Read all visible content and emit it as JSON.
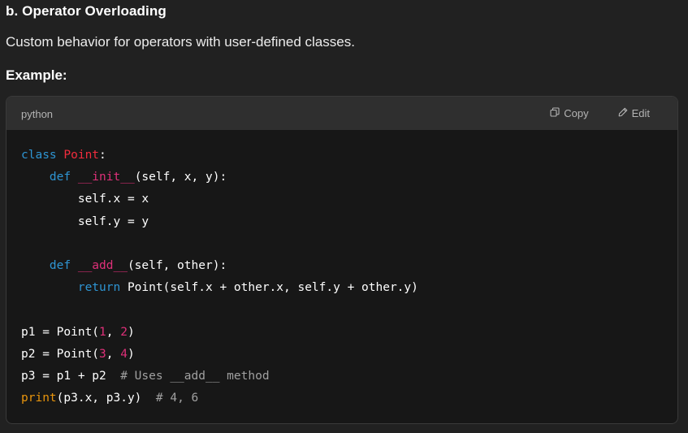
{
  "heading": "b. Operator Overloading",
  "description": "Custom behavior for operators with user-defined classes.",
  "example_label": "Example:",
  "code_block": {
    "language": "python",
    "copy_label": "Copy",
    "edit_label": "Edit",
    "lines": [
      [
        {
          "t": "class ",
          "c": "kw"
        },
        {
          "t": "Point",
          "c": "cls"
        },
        {
          "t": ":",
          "c": "t"
        }
      ],
      [
        {
          "t": "    ",
          "c": "t"
        },
        {
          "t": "def ",
          "c": "kw"
        },
        {
          "t": "__init__",
          "c": "fn"
        },
        {
          "t": "(self, x, y):",
          "c": "t"
        }
      ],
      [
        {
          "t": "        self.x = x",
          "c": "t"
        }
      ],
      [
        {
          "t": "        self.y = y",
          "c": "t"
        }
      ],
      [],
      [
        {
          "t": "    ",
          "c": "t"
        },
        {
          "t": "def ",
          "c": "kw"
        },
        {
          "t": "__add__",
          "c": "fn"
        },
        {
          "t": "(self, other):",
          "c": "t"
        }
      ],
      [
        {
          "t": "        ",
          "c": "t"
        },
        {
          "t": "return ",
          "c": "kw"
        },
        {
          "t": "Point(self.x + other.x, self.y + other.y)",
          "c": "t"
        }
      ],
      [],
      [
        {
          "t": "p1 = Point(",
          "c": "t"
        },
        {
          "t": "1",
          "c": "num"
        },
        {
          "t": ", ",
          "c": "t"
        },
        {
          "t": "2",
          "c": "num"
        },
        {
          "t": ")",
          "c": "t"
        }
      ],
      [
        {
          "t": "p2 = Point(",
          "c": "t"
        },
        {
          "t": "3",
          "c": "num"
        },
        {
          "t": ", ",
          "c": "t"
        },
        {
          "t": "4",
          "c": "num"
        },
        {
          "t": ")",
          "c": "t"
        }
      ],
      [
        {
          "t": "p3 = p1 + p2  ",
          "c": "t"
        },
        {
          "t": "# Uses __add__ method",
          "c": "cm"
        }
      ],
      [
        {
          "t": "print",
          "c": "bi"
        },
        {
          "t": "(p3.x, p3.y)  ",
          "c": "t"
        },
        {
          "t": "# 4, 6",
          "c": "cm"
        }
      ]
    ]
  },
  "colors": {
    "keyword": "#2e95d3",
    "class_name": "#f22c3d",
    "function_name": "#df3079",
    "number": "#df3079",
    "comment": "#a0a0a0",
    "builtin": "#e9950c"
  },
  "icons": {
    "copy": "copy-icon",
    "edit": "pencil-icon"
  }
}
